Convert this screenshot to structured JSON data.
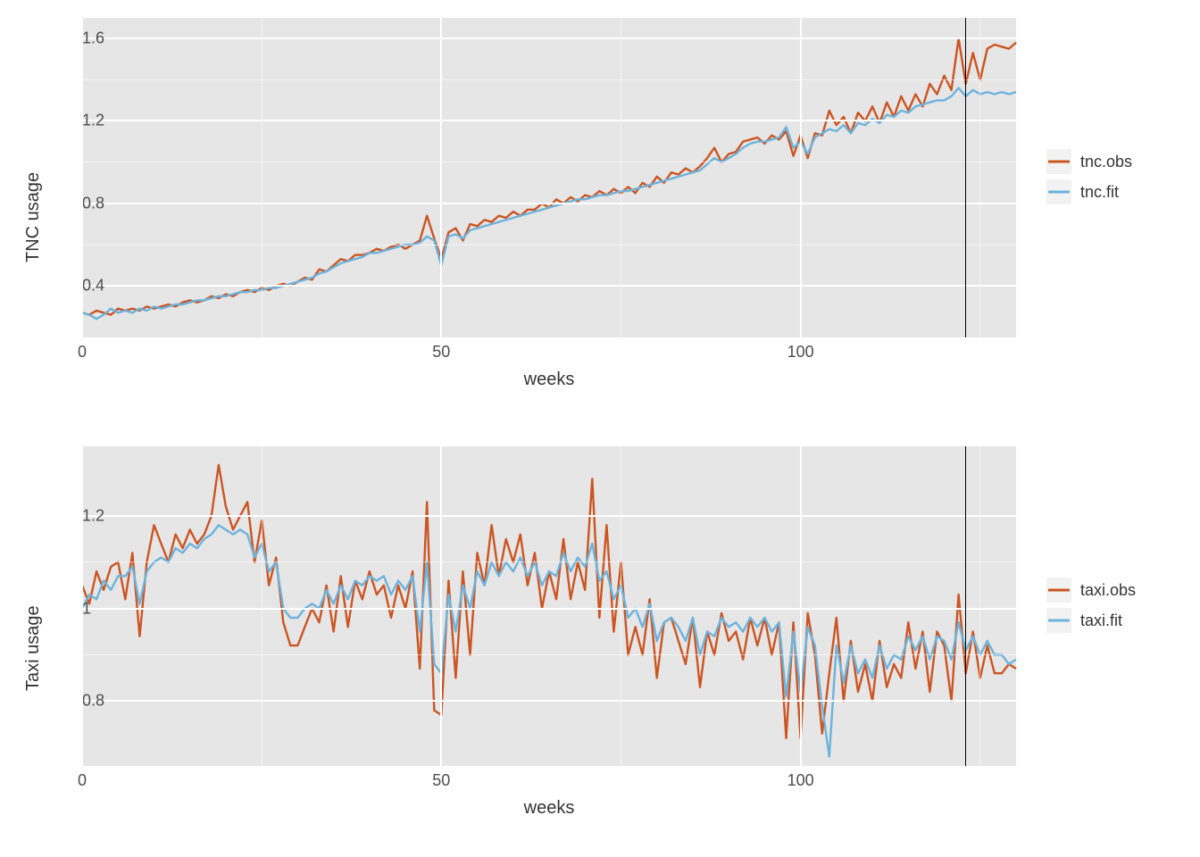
{
  "chart_data": [
    {
      "id": "tnc",
      "type": "line",
      "x": [
        0,
        1,
        2,
        3,
        4,
        5,
        6,
        7,
        8,
        9,
        10,
        11,
        12,
        13,
        14,
        15,
        16,
        17,
        18,
        19,
        20,
        21,
        22,
        23,
        24,
        25,
        26,
        27,
        28,
        29,
        30,
        31,
        32,
        33,
        34,
        35,
        36,
        37,
        38,
        39,
        40,
        41,
        42,
        43,
        44,
        45,
        46,
        47,
        48,
        49,
        50,
        51,
        52,
        53,
        54,
        55,
        56,
        57,
        58,
        59,
        60,
        61,
        62,
        63,
        64,
        65,
        66,
        67,
        68,
        69,
        70,
        71,
        72,
        73,
        74,
        75,
        76,
        77,
        78,
        79,
        80,
        81,
        82,
        83,
        84,
        85,
        86,
        87,
        88,
        89,
        90,
        91,
        92,
        93,
        94,
        95,
        96,
        97,
        98,
        99,
        100,
        101,
        102,
        103,
        104,
        105,
        106,
        107,
        108,
        109,
        110,
        111,
        112,
        113,
        114,
        115,
        116,
        117,
        118,
        119,
        120,
        121,
        122,
        123,
        124,
        125,
        126,
        127,
        128,
        129,
        130
      ],
      "series": [
        {
          "name": "tnc.obs",
          "color": "#cc5522",
          "values": [
            0.27,
            0.26,
            0.28,
            0.27,
            0.26,
            0.29,
            0.28,
            0.29,
            0.28,
            0.3,
            0.29,
            0.3,
            0.31,
            0.3,
            0.32,
            0.33,
            0.32,
            0.33,
            0.35,
            0.34,
            0.36,
            0.35,
            0.37,
            0.38,
            0.37,
            0.39,
            0.38,
            0.4,
            0.41,
            0.4,
            0.42,
            0.44,
            0.43,
            0.48,
            0.47,
            0.5,
            0.53,
            0.52,
            0.55,
            0.55,
            0.56,
            0.58,
            0.57,
            0.59,
            0.6,
            0.58,
            0.6,
            0.62,
            0.74,
            0.63,
            0.53,
            0.66,
            0.68,
            0.62,
            0.7,
            0.69,
            0.72,
            0.71,
            0.74,
            0.73,
            0.76,
            0.74,
            0.77,
            0.77,
            0.8,
            0.78,
            0.82,
            0.8,
            0.83,
            0.81,
            0.84,
            0.83,
            0.86,
            0.84,
            0.87,
            0.85,
            0.88,
            0.85,
            0.9,
            0.88,
            0.93,
            0.9,
            0.95,
            0.94,
            0.97,
            0.95,
            0.98,
            1.02,
            1.07,
            1.0,
            1.04,
            1.05,
            1.1,
            1.11,
            1.12,
            1.09,
            1.13,
            1.11,
            1.15,
            1.03,
            1.13,
            1.02,
            1.14,
            1.13,
            1.25,
            1.18,
            1.22,
            1.14,
            1.24,
            1.2,
            1.27,
            1.19,
            1.29,
            1.22,
            1.32,
            1.25,
            1.33,
            1.27,
            1.38,
            1.33,
            1.42,
            1.35,
            1.6,
            1.38,
            1.53,
            1.4,
            1.55,
            1.57,
            1.56,
            1.55,
            1.58
          ]
        },
        {
          "name": "tnc.fit",
          "color": "#6cb3dd",
          "values": [
            0.27,
            0.26,
            0.24,
            0.26,
            0.29,
            0.27,
            0.28,
            0.27,
            0.29,
            0.28,
            0.3,
            0.29,
            0.3,
            0.31,
            0.31,
            0.32,
            0.33,
            0.33,
            0.34,
            0.35,
            0.35,
            0.36,
            0.37,
            0.37,
            0.38,
            0.38,
            0.39,
            0.39,
            0.4,
            0.41,
            0.42,
            0.43,
            0.44,
            0.46,
            0.47,
            0.49,
            0.51,
            0.52,
            0.53,
            0.54,
            0.56,
            0.56,
            0.57,
            0.58,
            0.59,
            0.6,
            0.6,
            0.61,
            0.64,
            0.62,
            0.5,
            0.64,
            0.65,
            0.63,
            0.67,
            0.68,
            0.69,
            0.7,
            0.71,
            0.72,
            0.73,
            0.74,
            0.75,
            0.76,
            0.77,
            0.78,
            0.79,
            0.8,
            0.81,
            0.82,
            0.82,
            0.83,
            0.84,
            0.84,
            0.85,
            0.86,
            0.86,
            0.87,
            0.88,
            0.89,
            0.9,
            0.91,
            0.92,
            0.93,
            0.94,
            0.95,
            0.96,
            0.99,
            1.02,
            1.0,
            1.02,
            1.04,
            1.07,
            1.09,
            1.1,
            1.1,
            1.11,
            1.12,
            1.17,
            1.07,
            1.1,
            1.04,
            1.12,
            1.14,
            1.16,
            1.15,
            1.18,
            1.14,
            1.19,
            1.18,
            1.21,
            1.19,
            1.23,
            1.22,
            1.25,
            1.24,
            1.27,
            1.28,
            1.29,
            1.3,
            1.3,
            1.32,
            1.36,
            1.32,
            1.35,
            1.33,
            1.34,
            1.33,
            1.34,
            1.33,
            1.34
          ]
        }
      ],
      "xlabel": "weeks",
      "ylabel": "TNC usage",
      "xticks": [
        0,
        50,
        100
      ],
      "yticks": [
        0.4,
        0.8,
        1.2,
        1.6
      ],
      "xlim": [
        0,
        130
      ],
      "ylim": [
        0.15,
        1.7
      ],
      "vline_x": 123,
      "legend_items": [
        "tnc.obs",
        "tnc.fit"
      ]
    },
    {
      "id": "taxi",
      "type": "line",
      "x": [
        0,
        1,
        2,
        3,
        4,
        5,
        6,
        7,
        8,
        9,
        10,
        11,
        12,
        13,
        14,
        15,
        16,
        17,
        18,
        19,
        20,
        21,
        22,
        23,
        24,
        25,
        26,
        27,
        28,
        29,
        30,
        31,
        32,
        33,
        34,
        35,
        36,
        37,
        38,
        39,
        40,
        41,
        42,
        43,
        44,
        45,
        46,
        47,
        48,
        49,
        50,
        51,
        52,
        53,
        54,
        55,
        56,
        57,
        58,
        59,
        60,
        61,
        62,
        63,
        64,
        65,
        66,
        67,
        68,
        69,
        70,
        71,
        72,
        73,
        74,
        75,
        76,
        77,
        78,
        79,
        80,
        81,
        82,
        83,
        84,
        85,
        86,
        87,
        88,
        89,
        90,
        91,
        92,
        93,
        94,
        95,
        96,
        97,
        98,
        99,
        100,
        101,
        102,
        103,
        104,
        105,
        106,
        107,
        108,
        109,
        110,
        111,
        112,
        113,
        114,
        115,
        116,
        117,
        118,
        119,
        120,
        121,
        122,
        123,
        124,
        125,
        126,
        127,
        128,
        129,
        130
      ],
      "series": [
        {
          "name": "taxi.obs",
          "color": "#cc5522",
          "values": [
            1.05,
            1.01,
            1.08,
            1.04,
            1.09,
            1.1,
            1.02,
            1.12,
            0.94,
            1.1,
            1.18,
            1.14,
            1.1,
            1.16,
            1.13,
            1.17,
            1.14,
            1.16,
            1.2,
            1.31,
            1.22,
            1.17,
            1.2,
            1.23,
            1.1,
            1.19,
            1.05,
            1.11,
            0.97,
            0.92,
            0.92,
            0.96,
            1.0,
            0.97,
            1.05,
            0.95,
            1.07,
            0.96,
            1.06,
            1.02,
            1.08,
            1.03,
            1.05,
            0.98,
            1.05,
            1.0,
            1.08,
            0.87,
            1.23,
            0.78,
            0.77,
            1.06,
            0.85,
            1.08,
            0.9,
            1.12,
            1.05,
            1.18,
            1.07,
            1.15,
            1.1,
            1.16,
            1.05,
            1.12,
            1.0,
            1.08,
            1.02,
            1.15,
            1.02,
            1.1,
            1.04,
            1.28,
            0.98,
            1.18,
            0.95,
            1.1,
            0.9,
            0.96,
            0.9,
            1.02,
            0.85,
            0.97,
            0.98,
            0.93,
            0.88,
            0.98,
            0.83,
            0.95,
            0.9,
            0.99,
            0.93,
            0.95,
            0.89,
            0.98,
            0.92,
            0.98,
            0.9,
            0.97,
            0.72,
            0.97,
            0.72,
            0.99,
            0.9,
            0.73,
            0.86,
            0.98,
            0.8,
            0.93,
            0.82,
            0.88,
            0.8,
            0.93,
            0.83,
            0.88,
            0.85,
            0.97,
            0.87,
            0.95,
            0.82,
            0.95,
            0.92,
            0.8,
            1.03,
            0.86,
            0.95,
            0.85,
            0.92,
            0.86,
            0.86,
            0.88,
            0.87
          ]
        },
        {
          "name": "taxi.fit",
          "color": "#6cb3dd",
          "values": [
            1.0,
            1.03,
            1.02,
            1.06,
            1.04,
            1.07,
            1.07,
            1.09,
            1.01,
            1.08,
            1.1,
            1.11,
            1.1,
            1.13,
            1.12,
            1.14,
            1.13,
            1.15,
            1.16,
            1.18,
            1.17,
            1.16,
            1.17,
            1.16,
            1.11,
            1.14,
            1.08,
            1.1,
            1.0,
            0.98,
            0.98,
            1.0,
            1.01,
            1.0,
            1.04,
            1.01,
            1.05,
            1.02,
            1.06,
            1.05,
            1.07,
            1.06,
            1.07,
            1.03,
            1.06,
            1.04,
            1.07,
            0.95,
            1.1,
            0.88,
            0.86,
            1.03,
            0.95,
            1.05,
            1.0,
            1.08,
            1.05,
            1.1,
            1.07,
            1.1,
            1.08,
            1.11,
            1.07,
            1.1,
            1.05,
            1.08,
            1.07,
            1.12,
            1.08,
            1.11,
            1.09,
            1.14,
            1.06,
            1.08,
            1.02,
            1.05,
            0.98,
            1.0,
            0.96,
            1.01,
            0.93,
            0.97,
            0.98,
            0.96,
            0.93,
            0.98,
            0.9,
            0.95,
            0.94,
            0.98,
            0.96,
            0.97,
            0.95,
            0.98,
            0.96,
            0.98,
            0.95,
            0.97,
            0.81,
            0.95,
            0.82,
            0.96,
            0.92,
            0.79,
            0.68,
            0.92,
            0.84,
            0.92,
            0.86,
            0.89,
            0.85,
            0.92,
            0.87,
            0.9,
            0.89,
            0.94,
            0.91,
            0.94,
            0.89,
            0.94,
            0.93,
            0.89,
            0.97,
            0.91,
            0.94,
            0.9,
            0.93,
            0.9,
            0.9,
            0.88,
            0.89
          ]
        }
      ],
      "xlabel": "weeks",
      "ylabel": "Taxi usage",
      "xticks": [
        0,
        50,
        100
      ],
      "yticks": [
        0.8,
        1.0,
        1.2
      ],
      "xlim": [
        0,
        130
      ],
      "ylim": [
        0.66,
        1.35
      ],
      "vline_x": 123,
      "legend_items": [
        "taxi.obs",
        "taxi.fit"
      ]
    }
  ],
  "colors": {
    "obs": "#cc5522",
    "fit": "#6cb3dd"
  }
}
